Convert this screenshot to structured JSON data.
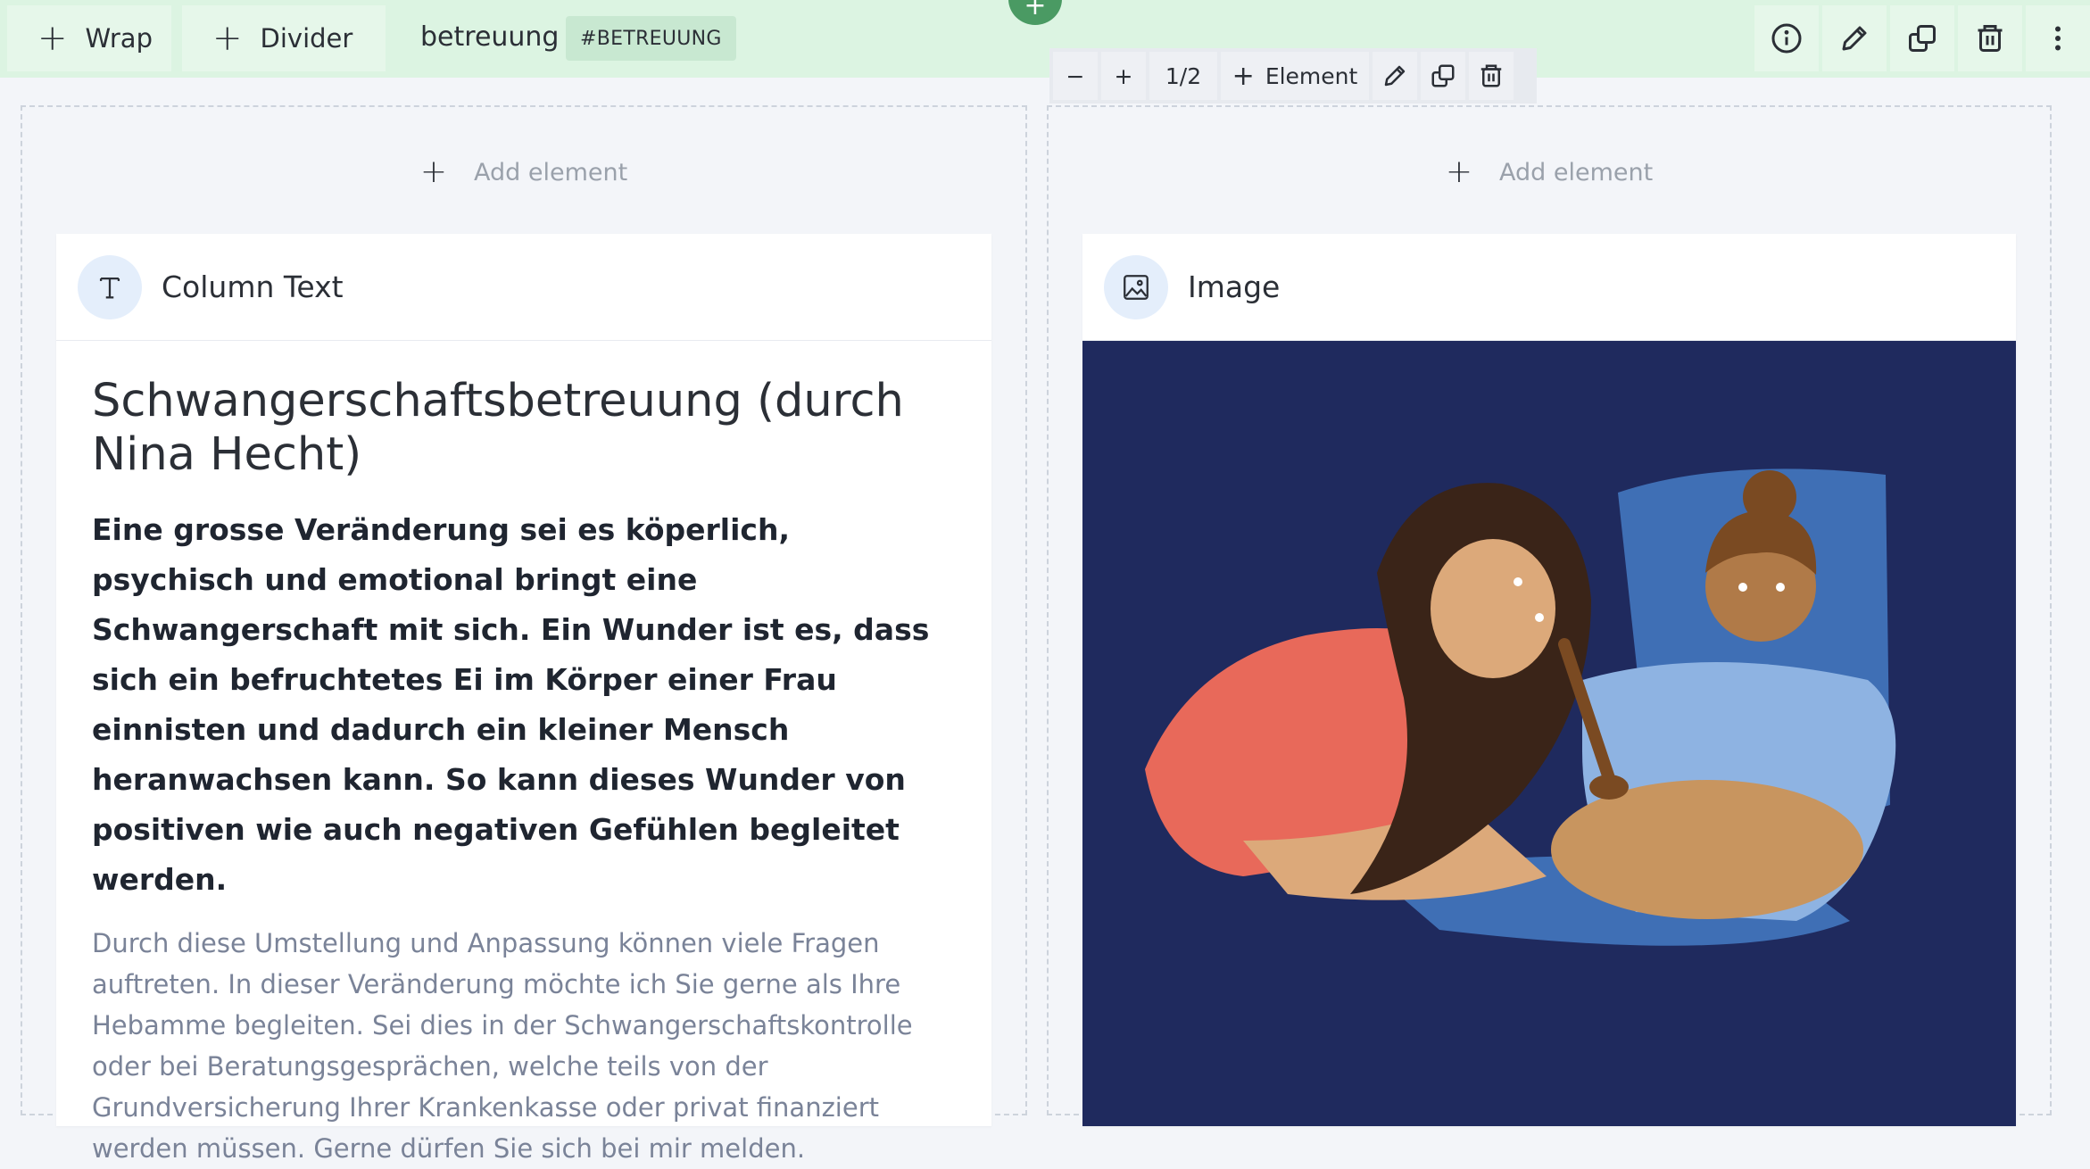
{
  "topbar": {
    "wrap_label": "Wrap",
    "divider_label": "Divider",
    "wrap_name": "betreuung",
    "anchor_badge": "#BETREUUNG",
    "tools": [
      "info-icon",
      "pencil-icon",
      "duplicate-icon",
      "trash-icon",
      "more-vertical-icon"
    ]
  },
  "column_toolbar": {
    "minus": "−",
    "plus": "+",
    "column_fraction": "1/2",
    "element_label": "Element"
  },
  "left_column": {
    "add_element": "Add element",
    "card": {
      "title": "Column Text",
      "heading": "Schwangerschaftsbetreuung (durch Nina Hecht)",
      "lead": "Eine grosse Veränderung sei es köperlich, psychisch und emotional bringt eine Schwangerschaft mit sich. Ein Wunder ist es, dass sich ein befruchtetes Ei im Körper einer Frau einnisten und dadurch ein kleiner Mensch heranwachsen kann. So kann dieses Wunder von positiven wie auch negativen Gefühlen begleitet werden.",
      "paragraph": "Durch diese Umstellung und Anpassung können viele Fragen auftreten. In dieser Veränderung möchte ich Sie gerne als Ihre Hebamme begleiten. Sei dies in der Schwangerschaftskontrolle oder bei Beratungsgesprächen, welche teils von der Grundversicherung Ihrer Krankenkasse oder privat finanziert werden müssen. Gerne dürfen Sie sich bei mir melden."
    }
  },
  "right_column": {
    "add_element": "Add element",
    "card": {
      "title": "Image",
      "image_background": "#1f2a5e"
    }
  },
  "colors": {
    "topbar_bg": "#dcf4e2",
    "accent_green": "#4a9a63",
    "page_bg": "#f3f5f9"
  }
}
